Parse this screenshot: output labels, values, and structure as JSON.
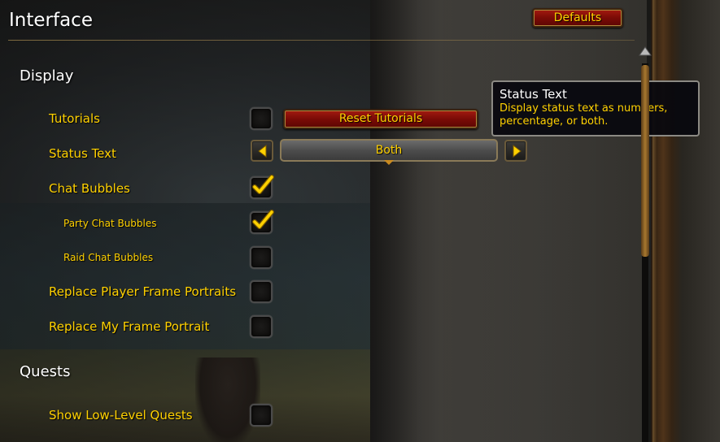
{
  "header": {
    "title": "Interface",
    "defaults_label": "Defaults"
  },
  "sections": {
    "display": "Display",
    "quests": "Quests"
  },
  "options": {
    "tutorials": {
      "label": "Tutorials",
      "checked": false,
      "button": "Reset Tutorials"
    },
    "status_text": {
      "label": "Status Text",
      "value": "Both"
    },
    "chat_bubbles": {
      "label": "Chat Bubbles",
      "checked": true
    },
    "party_chat_bubbles": {
      "label": "Party Chat Bubbles",
      "checked": true
    },
    "raid_chat_bubbles": {
      "label": "Raid Chat Bubbles",
      "checked": false
    },
    "replace_player_frame_portraits": {
      "label": "Replace Player Frame Portraits",
      "checked": false
    },
    "replace_my_frame_portrait": {
      "label": "Replace My Frame Portrait",
      "checked": false
    },
    "show_low_level_quests": {
      "label": "Show Low-Level Quests",
      "checked": false
    }
  },
  "tooltip": {
    "title": "Status Text",
    "body": "Display status text as numbers, percentage, or both."
  },
  "colors": {
    "label_gold": "#ffd100",
    "heading_white": "#ffffff",
    "button_red": "#8b0f08"
  },
  "icons": {
    "check": "checkmark-icon",
    "left": "arrow-left-icon",
    "right": "arrow-right-icon",
    "scroll_up": "scroll-up-icon"
  }
}
